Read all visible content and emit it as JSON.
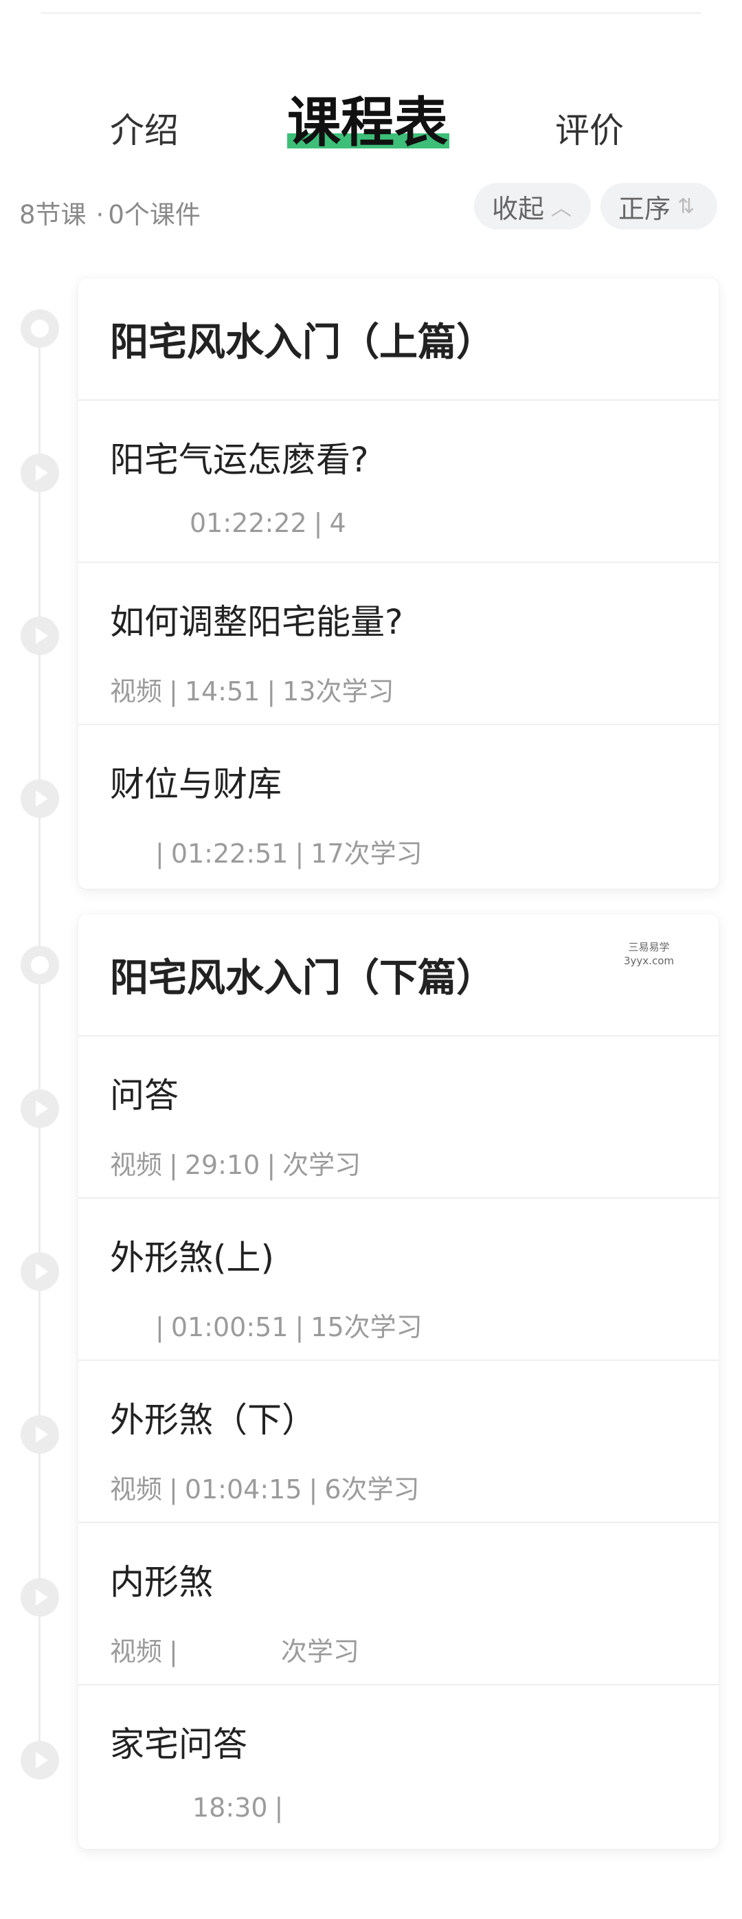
{
  "tabs": {
    "intro": "介绍",
    "schedule": "课程表",
    "review": "评价"
  },
  "meta": {
    "lessons": "8节课",
    "separator": "·",
    "files": "0个课件"
  },
  "controls": {
    "collapse_label": "收起",
    "collapse_glyph": "︿",
    "order_label": "正序",
    "order_glyph": "⇅"
  },
  "chapters": [
    {
      "title": "阳宅风水入门（上篇）",
      "lessons": [
        {
          "title": "阳宅气运怎麽看?",
          "type": "",
          "duration": "01:22:22",
          "views": "4"
        },
        {
          "title": "如何调整阳宅能量?",
          "type": "视频",
          "duration": "14:51",
          "views": "13次学习"
        },
        {
          "title": "财位与财库",
          "type": "",
          "duration": "01:22:51",
          "views": "17次学习"
        }
      ]
    },
    {
      "title": "阳宅风水入门（下篇）",
      "lessons": [
        {
          "title": "问答",
          "type": "视频",
          "duration": "29:10",
          "views": "次学习"
        },
        {
          "title": "外形煞(上)",
          "type": "",
          "duration": "01:00:51",
          "views": "15次学习"
        },
        {
          "title": "外形煞（下）",
          "type": "视频",
          "duration": "01:04:15",
          "views": "6次学习"
        },
        {
          "title": "内形煞",
          "type": "视频",
          "duration": "",
          "views": "次学习"
        },
        {
          "title": "家宅问答",
          "type": "",
          "duration": "18:30",
          "views": ""
        }
      ]
    }
  ],
  "watermark": {
    "line1": "三易易学",
    "line2": "3yyx.com"
  },
  "colors": {
    "accent": "#3dbf79",
    "muted_text": "#9b9b9b",
    "timeline": "#ececec"
  }
}
